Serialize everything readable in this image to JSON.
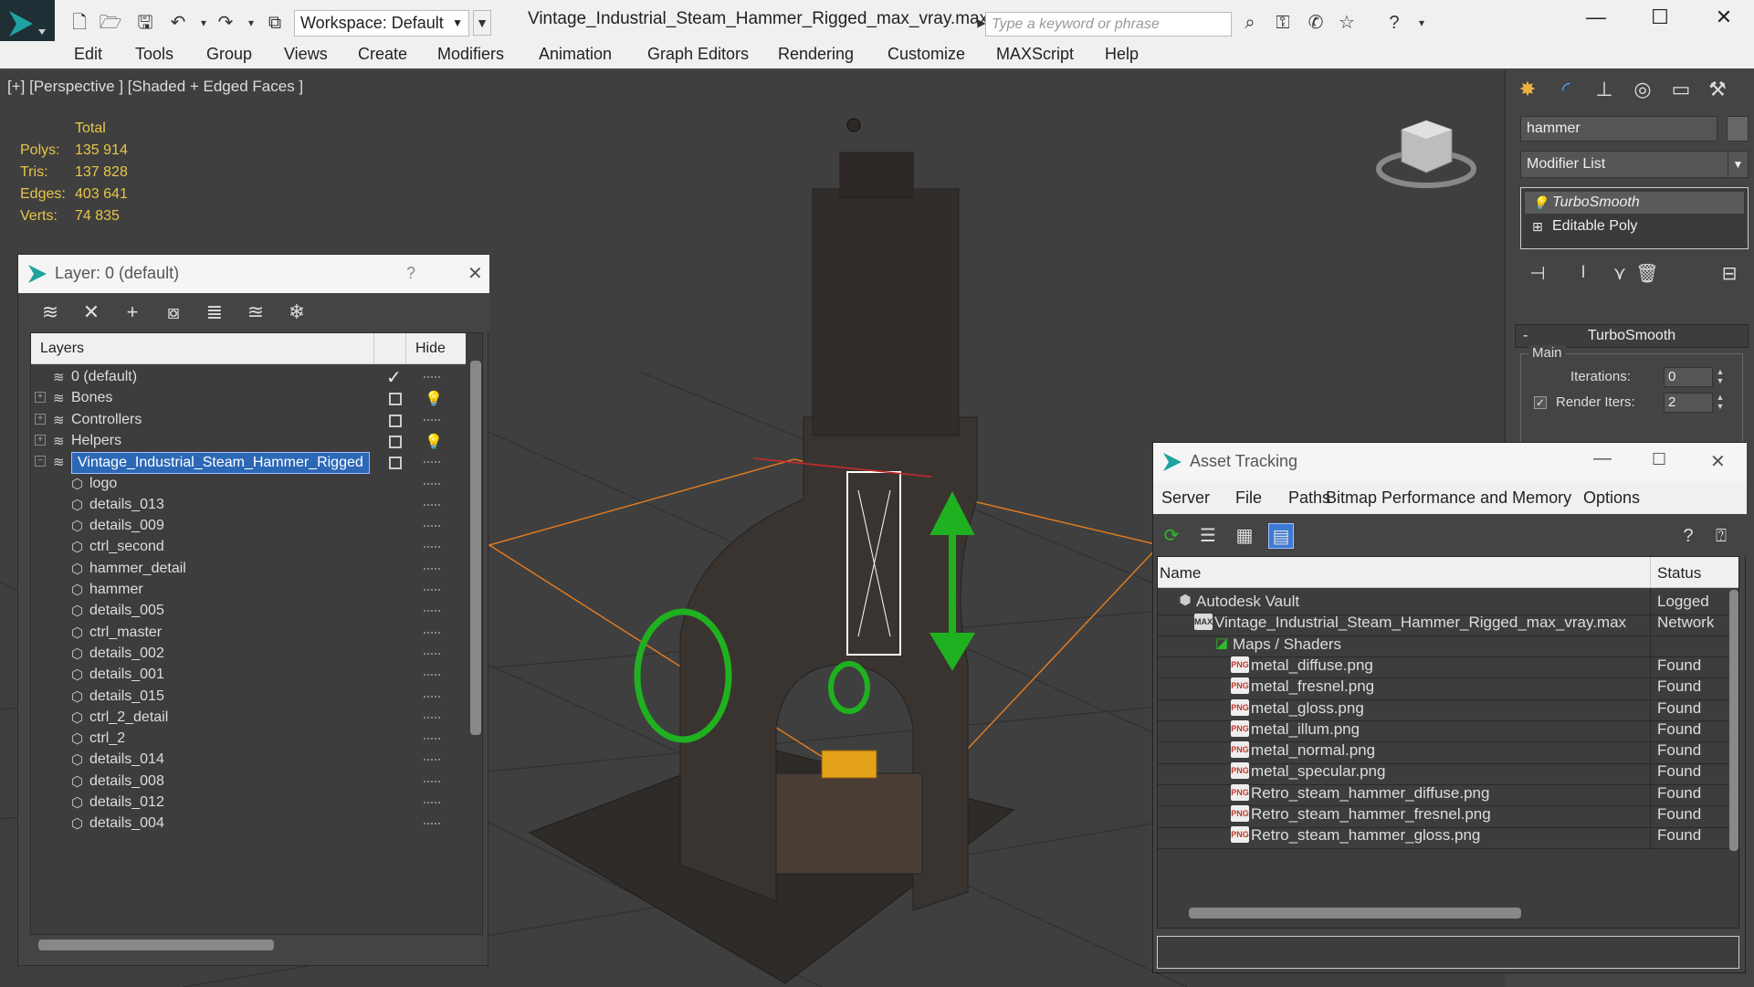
{
  "titlebar": {
    "workspace": "Workspace: Default",
    "file_title": "Vintage_Industrial_Steam_Hammer_Rigged_max_vray.max",
    "search_placeholder": "Type a keyword or phrase"
  },
  "menu": [
    "Edit",
    "Tools",
    "Group",
    "Views",
    "Create",
    "Modifiers",
    "Animation",
    "Graph Editors",
    "Rendering",
    "Customize",
    "MAXScript",
    "Help"
  ],
  "viewport": {
    "label": "[+] [Perspective ] [Shaded + Edged Faces ]",
    "stats": {
      "header": "Total",
      "rows": [
        {
          "label": "Polys:",
          "value": "135 914"
        },
        {
          "label": "Tris:",
          "value": "137 828"
        },
        {
          "label": "Edges:",
          "value": "403 641"
        },
        {
          "label": "Verts:",
          "value": "74 835"
        }
      ]
    }
  },
  "layer_dialog": {
    "title": "Layer: 0 (default)",
    "help": "?",
    "col_layers": "Layers",
    "col_hide": "Hide",
    "rows": [
      {
        "name": "0 (default)",
        "level": 0,
        "expand": false,
        "current": true,
        "bulb": false
      },
      {
        "name": "Bones",
        "level": 0,
        "expand": true,
        "current": false,
        "bulb": true
      },
      {
        "name": "Controllers",
        "level": 0,
        "expand": true,
        "current": false,
        "bulb": false
      },
      {
        "name": "Helpers",
        "level": 0,
        "expand": true,
        "current": false,
        "bulb": true
      },
      {
        "name": "Vintage_Industrial_Steam_Hammer_Rigged",
        "level": 0,
        "expand": true,
        "current": false,
        "bulb": false,
        "selected": true
      },
      {
        "name": "logo",
        "level": 1
      },
      {
        "name": "details_013",
        "level": 1
      },
      {
        "name": "details_009",
        "level": 1
      },
      {
        "name": "ctrl_second",
        "level": 1
      },
      {
        "name": "hammer_detail",
        "level": 1
      },
      {
        "name": "hammer",
        "level": 1
      },
      {
        "name": "details_005",
        "level": 1
      },
      {
        "name": "ctrl_master",
        "level": 1
      },
      {
        "name": "details_002",
        "level": 1
      },
      {
        "name": "details_001",
        "level": 1
      },
      {
        "name": "details_015",
        "level": 1
      },
      {
        "name": "ctrl_2_detail",
        "level": 1
      },
      {
        "name": "ctrl_2",
        "level": 1
      },
      {
        "name": "details_014",
        "level": 1
      },
      {
        "name": "details_008",
        "level": 1
      },
      {
        "name": "details_012",
        "level": 1
      },
      {
        "name": "details_004",
        "level": 1
      }
    ]
  },
  "command_panel": {
    "object_name": "hammer",
    "modifier_list": "Modifier List",
    "stack": [
      "TurboSmooth",
      "Editable Poly"
    ],
    "rollout_title": "TurboSmooth",
    "group_main": "Main",
    "iterations_label": "Iterations:",
    "iterations_value": "0",
    "render_iters_label": "Render Iters:",
    "render_iters_value": "2"
  },
  "asset_tracking": {
    "title": "Asset Tracking",
    "menu": [
      "Server",
      "File",
      "Paths",
      "Bitmap Performance and Memory",
      "Options"
    ],
    "col_name": "Name",
    "col_status": "Status",
    "rows": [
      {
        "name": "Autodesk Vault",
        "status": "Logged",
        "indent": 1,
        "icon": "vault"
      },
      {
        "name": "Vintage_Industrial_Steam_Hammer_Rigged_max_vray.max",
        "status": "Network",
        "indent": 2,
        "icon": "max"
      },
      {
        "name": "Maps / Shaders",
        "status": "",
        "indent": 3,
        "icon": "maps"
      },
      {
        "name": "metal_diffuse.png",
        "status": "Found",
        "indent": 4,
        "icon": "png"
      },
      {
        "name": "metal_fresnel.png",
        "status": "Found",
        "indent": 4,
        "icon": "png"
      },
      {
        "name": "metal_gloss.png",
        "status": "Found",
        "indent": 4,
        "icon": "png"
      },
      {
        "name": "metal_illum.png",
        "status": "Found",
        "indent": 4,
        "icon": "png"
      },
      {
        "name": "metal_normal.png",
        "status": "Found",
        "indent": 4,
        "icon": "png"
      },
      {
        "name": "metal_specular.png",
        "status": "Found",
        "indent": 4,
        "icon": "png"
      },
      {
        "name": "Retro_steam_hammer_diffuse.png",
        "status": "Found",
        "indent": 4,
        "icon": "png"
      },
      {
        "name": "Retro_steam_hammer_fresnel.png",
        "status": "Found",
        "indent": 4,
        "icon": "png"
      },
      {
        "name": "Retro_steam_hammer_gloss.png",
        "status": "Found",
        "indent": 4,
        "icon": "png"
      }
    ]
  },
  "colors": {
    "stats_yellow": "#e8c54a",
    "selection_blue": "#2c68b6",
    "gizmo_green": "#1fb11f",
    "grid_orange": "#e07a1f"
  }
}
